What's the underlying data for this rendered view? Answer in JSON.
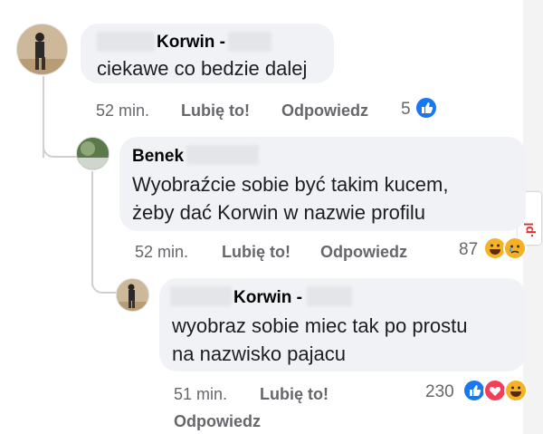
{
  "comments": [
    {
      "author": "Korwin -",
      "text": "ciekawe co bedzie dalej",
      "time": "52 min.",
      "like": "Lubię to!",
      "reply": "Odpowiedz",
      "reactions_count": "5",
      "reactions": [
        "like"
      ]
    },
    {
      "author": "Benek",
      "text": "Wyobraźcie sobie być takim kucem,\nżeby dać Korwin w nazwie profilu",
      "time": "52 min.",
      "like": "Lubię to!",
      "reply": "Odpowiedz",
      "reactions_count": "87",
      "reactions": [
        "haha",
        "sad"
      ]
    },
    {
      "author": "Korwin -",
      "text": "wyobraz sobie miec tak po prostu\nna nazwisko pajacu",
      "time": "51 min.",
      "like": "Lubię to!",
      "reply": "Odpowiedz",
      "reactions_count": "230",
      "reactions": [
        "like",
        "love",
        "haha"
      ]
    }
  ],
  "watermark": {
    "prefix": "jeja",
    "suffix": ".pl"
  },
  "colors": {
    "bubble": "#f0f2f5",
    "meta": "#65676b",
    "like_blue": "#1877f2",
    "love_red": "#f33e58",
    "haha_yellow": "#f7b125"
  }
}
